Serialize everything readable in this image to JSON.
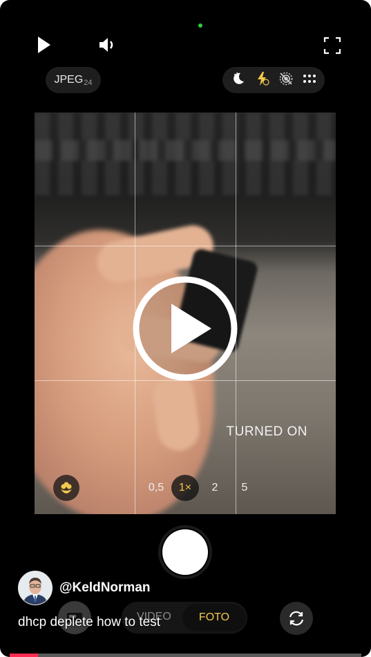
{
  "top_controls": {
    "play_icon": "play-icon",
    "volume_icon": "volume-icon",
    "fullscreen_icon": "fullscreen-icon"
  },
  "camera": {
    "format_label": "JPEG",
    "format_sub": "24",
    "mode_icons": [
      "night-mode-icon",
      "flash-auto-icon",
      "live-off-icon",
      "more-grid-icon"
    ],
    "overlay_text": "TURNED ON",
    "zoom_options": [
      {
        "label": "0,5",
        "active": false
      },
      {
        "label": "1×",
        "active": true
      },
      {
        "label": "2",
        "active": false
      },
      {
        "label": "5",
        "active": false
      }
    ],
    "capture_modes": {
      "video": "VIDEO",
      "photo": "FOTO"
    }
  },
  "post": {
    "username": "@KeldNorman",
    "caption": "dhcp deplete how to test"
  },
  "progress": 0.08,
  "colors": {
    "accent_yellow": "#f2c94c",
    "progress_red": "#fe2c55",
    "status_green": "#2ecc40"
  }
}
